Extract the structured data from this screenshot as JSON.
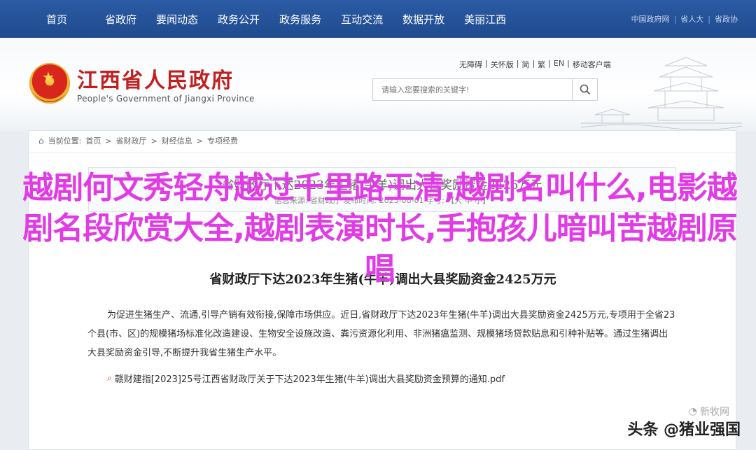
{
  "topnav": {
    "items": [
      {
        "label": "首页"
      },
      {
        "label": "省政府"
      },
      {
        "label": "要闻动态"
      },
      {
        "label": "政务公开"
      },
      {
        "label": "政务服务"
      },
      {
        "label": "互动交流"
      },
      {
        "label": "数据开放"
      },
      {
        "label": "美丽江西"
      }
    ],
    "right_links": [
      "中国政府网",
      "省人大",
      "省政协"
    ]
  },
  "header": {
    "title": "江西省人民政府",
    "subtitle": "People's Government of Jiangxi Province",
    "lang_links": [
      "无障碍",
      "关怀版",
      "简",
      "繁",
      "EN",
      "移动客户端"
    ],
    "search_placeholder": "请输入您要搜索的关键字!"
  },
  "breadcrumb": {
    "label": "当前位置:",
    "items": [
      "首页",
      "省财政厅",
      "财经信息",
      "专项经费"
    ]
  },
  "meta": {
    "title": "省财政厅下达2023年生猪(牛羊)调出大县奖励资金2425万元",
    "line": "信息来源: 省财政厅 发布时间: 2023-08-01 字号: 【大 中 小】"
  },
  "article": {
    "title": "省财政厅下达2023年生猪(牛羊)调出大县奖励资金2425万元",
    "body": "为促进生猪生产、流通,引导产销有效衔接,保障市场供应。近日,省财政厅下达2023年生猪(牛羊)调出大县奖励资金2425万元,专项用于全省23个县(市、区)的规模猪场标准化改造建设、生物安全设施改造、粪污资源化利用、非洲猪瘟监测、规模猪场贷款贴息和引种补贴等。通过生猪调出大县奖励资金引导,不断提升我省生猪生产水平。",
    "attachment": "赣财建指[2023]25号江西省财政厅关于下达2023年生猪(牛羊)调出大县奖励资金预算的通知.pdf"
  },
  "overlay": {
    "text": "越剧何文秀轻舟越过千里路王清,越剧名叫什么,电影越剧名段欣赏大全,越剧表演时长,手抱孩儿暗叫苦越剧原唱"
  },
  "watermarks": {
    "small": "新牧网",
    "main": "头条 @猪业强国"
  },
  "colors": {
    "nav_bg": "#2455a0",
    "title_red": "#c21f1f",
    "overlay_magenta": "#e13ae6"
  }
}
